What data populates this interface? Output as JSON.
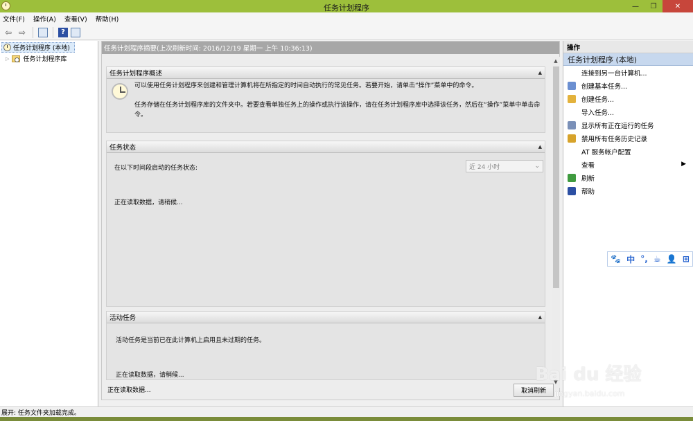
{
  "window": {
    "title": "任务计划程序",
    "minimize": "—",
    "restore": "❐",
    "close": "✕"
  },
  "menu": [
    "文件(F)",
    "操作(A)",
    "查看(V)",
    "帮助(H)"
  ],
  "toolbar": {
    "back": "⇦",
    "forward": "⇨",
    "help": "?"
  },
  "tree": {
    "root": "任务计划程序 (本地)",
    "child": "任务计划程序库"
  },
  "center": {
    "header": "任务计划程序摘要(上次刷新时间: 2016/12/19 星期一 上午 10:36:13)",
    "overview": {
      "title": "任务计划程序概述",
      "p1": "可以使用任务计划程序来创建和管理计算机将在所指定的时间自动执行的常见任务。若要开始，请单击“操作”菜单中的命令。",
      "p2": "任务存储在任务计划程序库的文件夹中。若要查看单独任务上的操作或执行该操作，请在任务计划程序库中选择该任务，然后在“操作”菜单中单击命令。"
    },
    "status": {
      "title": "任务状态",
      "label": "在以下时间段启动的任务状态:",
      "range": "近 24 小时",
      "loading": "正在读取数据，请稍候..."
    },
    "active": {
      "title": "活动任务",
      "desc": "活动任务是当前已在此计算机上启用且未过期的任务。",
      "loading": "正在读取数据，请稍候..."
    },
    "footer_status": "正在读取数据...",
    "cancel": "取消刷新"
  },
  "actions": {
    "header": "操作",
    "group": "任务计划程序 (本地)",
    "items": [
      {
        "label": "连接到另一台计算机...",
        "icon": "none"
      },
      {
        "label": "创建基本任务...",
        "icon": "create-basic-task-icon",
        "color": "#6b8fd1"
      },
      {
        "label": "创建任务...",
        "icon": "create-task-icon",
        "color": "#e3b23c"
      },
      {
        "label": "导入任务...",
        "icon": "none"
      },
      {
        "label": "显示所有正在运行的任务",
        "icon": "running-tasks-icon",
        "color": "#7a90b8"
      },
      {
        "label": "禁用所有任务历史记录",
        "icon": "disable-history-icon",
        "color": "#d7a32b"
      },
      {
        "label": "AT 服务帐户配置",
        "icon": "none"
      },
      {
        "label": "查看",
        "icon": "none",
        "submenu": true
      },
      {
        "label": "刷新",
        "icon": "refresh-icon",
        "color": "#3f9b3f"
      },
      {
        "label": "帮助",
        "icon": "help-icon",
        "color": "#2c4fa3"
      }
    ]
  },
  "ime": {
    "items": [
      "🐾",
      "中",
      "°,",
      "☕",
      "👤",
      "⊞"
    ]
  },
  "watermark": {
    "text": "Bai du 经验",
    "sub": "jingyan.baidu.com"
  },
  "statusbar": {
    "text": "展开: 任务文件夹加载完成。"
  }
}
